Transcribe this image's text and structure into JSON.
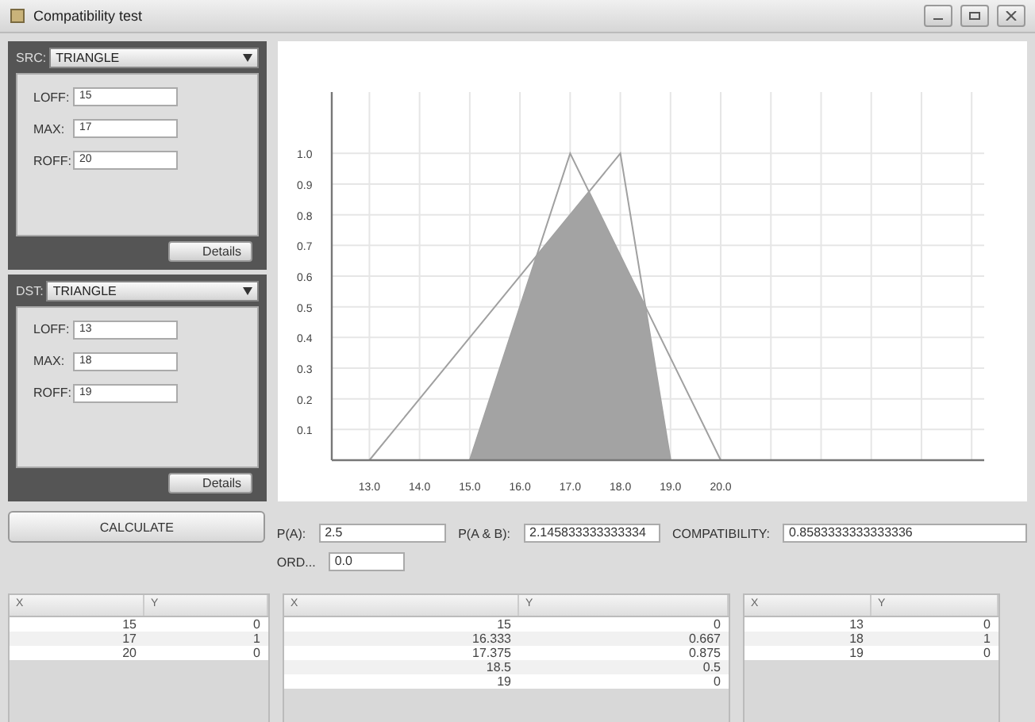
{
  "window": {
    "title": "Compatibility test"
  },
  "panels": [
    {
      "label": "SRC:",
      "function": "TRIANGLE",
      "fields": [
        {
          "label": "LOFF:",
          "value": "15"
        },
        {
          "label": "MAX:",
          "value": "17"
        },
        {
          "label": "ROFF:",
          "value": "20"
        }
      ],
      "button": "Details"
    },
    {
      "label": "DST:",
      "function": "TRIANGLE",
      "fields": [
        {
          "label": "LOFF:",
          "value": "13"
        },
        {
          "label": "MAX:",
          "value": "18"
        },
        {
          "label": "ROFF:",
          "value": "19"
        }
      ],
      "button": "Details"
    }
  ],
  "chart": {
    "chart_data": {
      "type": "line",
      "grid": true,
      "xlim": [
        12.25,
        25.25
      ],
      "ylim": [
        0,
        1.2
      ],
      "xticks": [
        {
          "value": 13,
          "label": "13.0"
        },
        {
          "value": 14,
          "label": "14.0"
        },
        {
          "value": 15,
          "label": "15.0"
        },
        {
          "value": 16,
          "label": "16.0"
        },
        {
          "value": 17,
          "label": "17.0"
        },
        {
          "value": 18,
          "label": "18.0"
        },
        {
          "value": 19,
          "label": "19.0"
        },
        {
          "value": 20,
          "label": "20.0"
        }
      ],
      "yticks": [
        {
          "value": 0.1,
          "label": "0.1"
        },
        {
          "value": 0.2,
          "label": "0.2"
        },
        {
          "value": 0.3,
          "label": "0.3"
        },
        {
          "value": 0.4,
          "label": "0.4"
        },
        {
          "value": 0.5,
          "label": "0.5"
        },
        {
          "value": 0.6,
          "label": "0.6"
        },
        {
          "value": 0.7,
          "label": "0.7"
        },
        {
          "value": 0.8,
          "label": "0.8"
        },
        {
          "value": 0.9,
          "label": "0.9"
        },
        {
          "value": 1.0,
          "label": "1.0"
        }
      ],
      "series": [
        {
          "type": "line",
          "color": "#a0a0a0",
          "x": [
            15,
            17,
            20
          ],
          "values": [
            0,
            1,
            0
          ]
        },
        {
          "type": "line",
          "color": "#a0a0a0",
          "x": [
            13,
            18,
            19
          ],
          "values": [
            0,
            1,
            0
          ]
        },
        {
          "type": "area",
          "color": "#a3a3a3",
          "x": [
            15,
            16.333,
            17.375,
            18.5,
            19
          ],
          "values": [
            0,
            0.667,
            0.875,
            0.5,
            0
          ]
        }
      ]
    }
  },
  "calculate_button": "CALCULATE",
  "results": [
    {
      "label": "P(A):",
      "value": "2.5"
    },
    {
      "label": "P(A & B):",
      "value": "2.145833333333334"
    },
    {
      "label": "COMPATIBILITY:",
      "value": "0.8583333333333336"
    }
  ],
  "ord": {
    "label": "ORD...",
    "value": "0.0"
  },
  "tables": [
    {
      "columns": [
        "X",
        "Y"
      ],
      "rows": [
        [
          "15",
          "0"
        ],
        [
          "17",
          "1"
        ],
        [
          "20",
          "0"
        ]
      ]
    },
    {
      "columns": [
        "X",
        "Y"
      ],
      "rows": [
        [
          "15",
          "0"
        ],
        [
          "16.333",
          "0.667"
        ],
        [
          "17.375",
          "0.875"
        ],
        [
          "18.5",
          "0.5"
        ],
        [
          "19",
          "0"
        ]
      ]
    },
    {
      "columns": [
        "X",
        "Y"
      ],
      "rows": [
        [
          "13",
          "0"
        ],
        [
          "18",
          "1"
        ],
        [
          "19",
          "0"
        ]
      ]
    }
  ]
}
